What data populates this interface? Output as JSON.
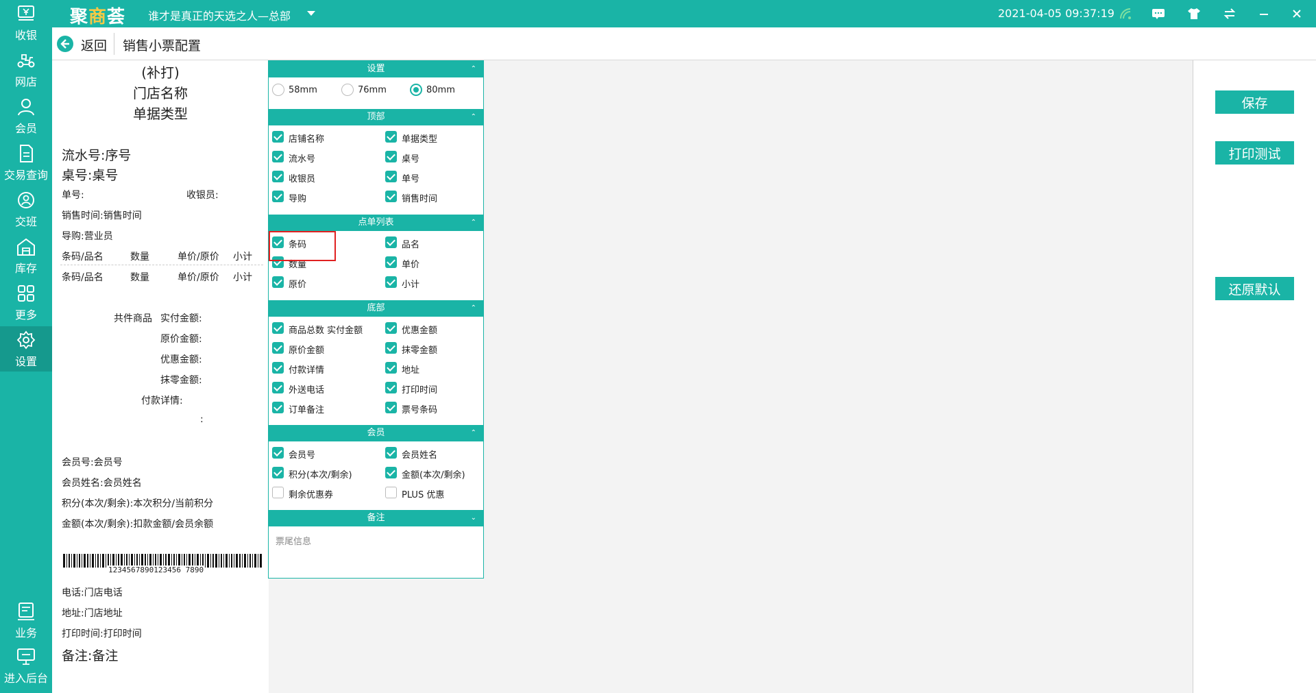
{
  "app": {
    "logo_main": "聚",
    "logo_accent": "商",
    "logo_tail": "荟",
    "store": "谁才是真正的天选之人—总部",
    "datetime": "2021-04-05 09:37:19"
  },
  "sidebar": {
    "items": [
      {
        "label": "收银",
        "icon": "cashier-icon"
      },
      {
        "label": "网店",
        "icon": "scooter-icon"
      },
      {
        "label": "会员",
        "icon": "member-icon"
      },
      {
        "label": "交易查询",
        "icon": "document-icon"
      },
      {
        "label": "交班",
        "icon": "shift-icon"
      },
      {
        "label": "库存",
        "icon": "warehouse-icon"
      },
      {
        "label": "更多",
        "icon": "grid-icon"
      },
      {
        "label": "设置",
        "icon": "gear-icon"
      },
      {
        "label": "业务",
        "icon": "business-icon"
      },
      {
        "label": "进入后台",
        "icon": "monitor-icon"
      }
    ]
  },
  "header": {
    "back": "返回",
    "title": "销售小票配置"
  },
  "receipt": {
    "reprint": "(补打)",
    "store_name": "门店名称",
    "doc_type": "单据类型",
    "serial": "流水号:序号",
    "table": "桌号:桌号",
    "order_no": "单号:",
    "cashier": "收银员:",
    "sale_time": "销售时间:销售时间",
    "guide": "导购:营业员",
    "col_barcode": "条码/品名",
    "col_qty": "数量",
    "col_price": "单价/原价",
    "col_subtotal": "小计",
    "total_items": "共件商品",
    "paid": "实付金额:",
    "original": "原价金额:",
    "discount": "优惠金额:",
    "rounding": "抹零金额:",
    "payment_detail": "付款详情:",
    "colon": ":",
    "member_no": "会员号:会员号",
    "member_name": "会员姓名:会员姓名",
    "points": "积分(本次/剩余):本次积分/当前积分",
    "amount": "金额(本次/剩余):扣款金额/会员余额",
    "barcode_digits": "1234567890123456 7890",
    "phone": "电话:门店电话",
    "address": "地址:门店地址",
    "print_time": "打印时间:打印时间",
    "remark": "备注:备注"
  },
  "settings": {
    "sections": {
      "settings": "设置",
      "top": "顶部",
      "order_list": "点单列表",
      "bottom": "底部",
      "member": "会员",
      "remark": "备注"
    },
    "paper": {
      "options": [
        "58mm",
        "76mm",
        "80mm"
      ],
      "selected": "80mm"
    },
    "top": [
      {
        "label": "店铺名称",
        "checked": true
      },
      {
        "label": "单据类型",
        "checked": true
      },
      {
        "label": "流水号",
        "checked": true
      },
      {
        "label": "桌号",
        "checked": true
      },
      {
        "label": "收银员",
        "checked": true
      },
      {
        "label": "单号",
        "checked": true
      },
      {
        "label": "导购",
        "checked": true
      },
      {
        "label": "销售时间",
        "checked": true
      }
    ],
    "order_list": [
      {
        "label": "条码",
        "checked": true
      },
      {
        "label": "品名",
        "checked": true
      },
      {
        "label": "数量",
        "checked": true
      },
      {
        "label": "单价",
        "checked": true
      },
      {
        "label": "原价",
        "checked": true
      },
      {
        "label": "小计",
        "checked": true
      }
    ],
    "bottom": [
      {
        "label": "商品总数 实付金额",
        "checked": true
      },
      {
        "label": "优惠金额",
        "checked": true
      },
      {
        "label": "原价金额",
        "checked": true
      },
      {
        "label": "抹零金额",
        "checked": true
      },
      {
        "label": "付款详情",
        "checked": true
      },
      {
        "label": "地址",
        "checked": true
      },
      {
        "label": "外送电话",
        "checked": true
      },
      {
        "label": "打印时间",
        "checked": true
      },
      {
        "label": "订单备注",
        "checked": true
      },
      {
        "label": "票号条码",
        "checked": true
      }
    ],
    "member": [
      {
        "label": "会员号",
        "checked": true
      },
      {
        "label": "会员姓名",
        "checked": true
      },
      {
        "label": "积分(本次/剩余)",
        "checked": true
      },
      {
        "label": "金额(本次/剩余)",
        "checked": true
      },
      {
        "label": "剩余优惠券",
        "checked": false
      },
      {
        "label": "PLUS 优惠",
        "checked": false
      }
    ],
    "remark_placeholder": "票尾信息"
  },
  "actions": {
    "save": "保存",
    "print_test": "打印测试",
    "restore": "还原默认"
  }
}
